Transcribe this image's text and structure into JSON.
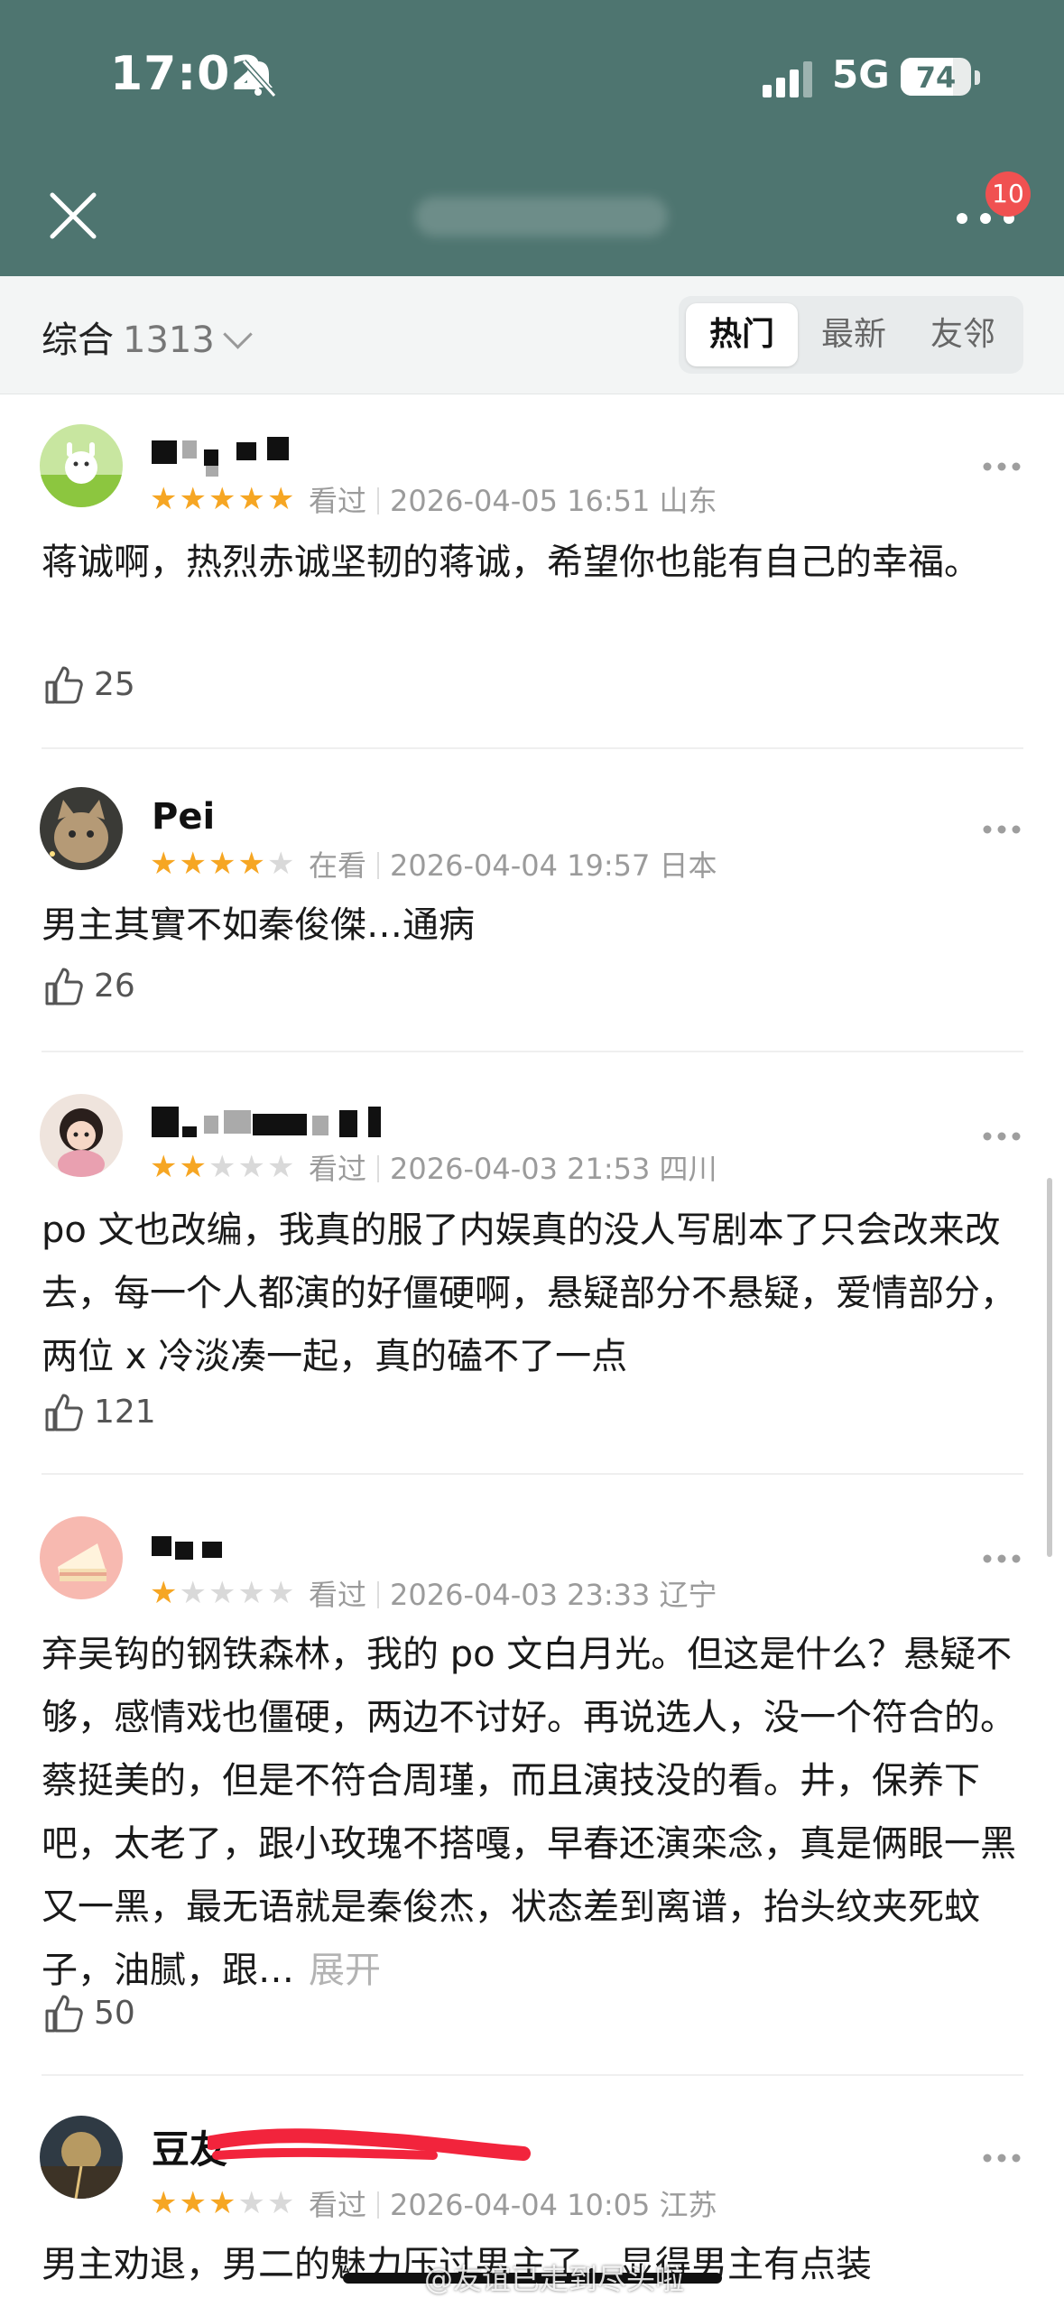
{
  "status_bar": {
    "time": "17:02",
    "network": "5G",
    "battery": "74",
    "battery_level": 0.74,
    "notification_count": "10"
  },
  "filter_bar": {
    "sort_label": "综合",
    "total_count": "1313",
    "tabs": [
      "热门",
      "最新",
      "友邻"
    ],
    "active_tab": "热门"
  },
  "reviews": [
    {
      "rating": 5,
      "status": "看过",
      "date": "2026-04-05 16:51",
      "location": "山东",
      "text": "蒋诚啊，热烈赤诚坚韧的蒋诚，希望你也能有自己的幸福。",
      "likes": "25"
    },
    {
      "username": "Pei",
      "rating": 4,
      "status": "在看",
      "date": "2026-04-04 19:57",
      "location": "日本",
      "text": "男主其實不如秦俊傑…通病",
      "likes": "26"
    },
    {
      "rating": 2,
      "status": "看过",
      "date": "2026-04-03 21:53",
      "location": "四川",
      "text": "po 文也改编，我真的服了内娱真的没人写剧本了只会改来改去，每一个人都演的好僵硬啊，悬疑部分不悬疑，爱情部分，两位 x 冷淡凑一起，真的磕不了一点",
      "likes": "121"
    },
    {
      "rating": 1,
      "status": "看过",
      "date": "2026-04-03 23:33",
      "location": "辽宁",
      "text": "弃吴钩的钢铁森林，我的 po 文白月光。但这是什么？悬疑不够，感情戏也僵硬，两边不讨好。再说选人，没一个符合的。蔡挺美的，但是不符合周瑾，而且演技没的看。井，保养下吧，太老了，跟小玫瑰不搭嘎，早春还演栾念，真是俩眼一黑又一黑，最无语就是秦俊杰，状态差到离谱，抬头纹夹死蚊子，油腻，跟…",
      "expand_label": "展开",
      "likes": "50"
    },
    {
      "username": "豆友",
      "rating": 3,
      "status": "看过",
      "date": "2026-04-04 10:05",
      "location": "江苏",
      "text": "男主劝退，男二的魅力压过男主了，显得男主有点装"
    }
  ],
  "watermark": "@友谊已走到尽头啦",
  "colors": {
    "header_bg": "#4e7570",
    "star_on": "#f6a623",
    "star_off": "#d9d9d9",
    "badge": "#f05151"
  }
}
